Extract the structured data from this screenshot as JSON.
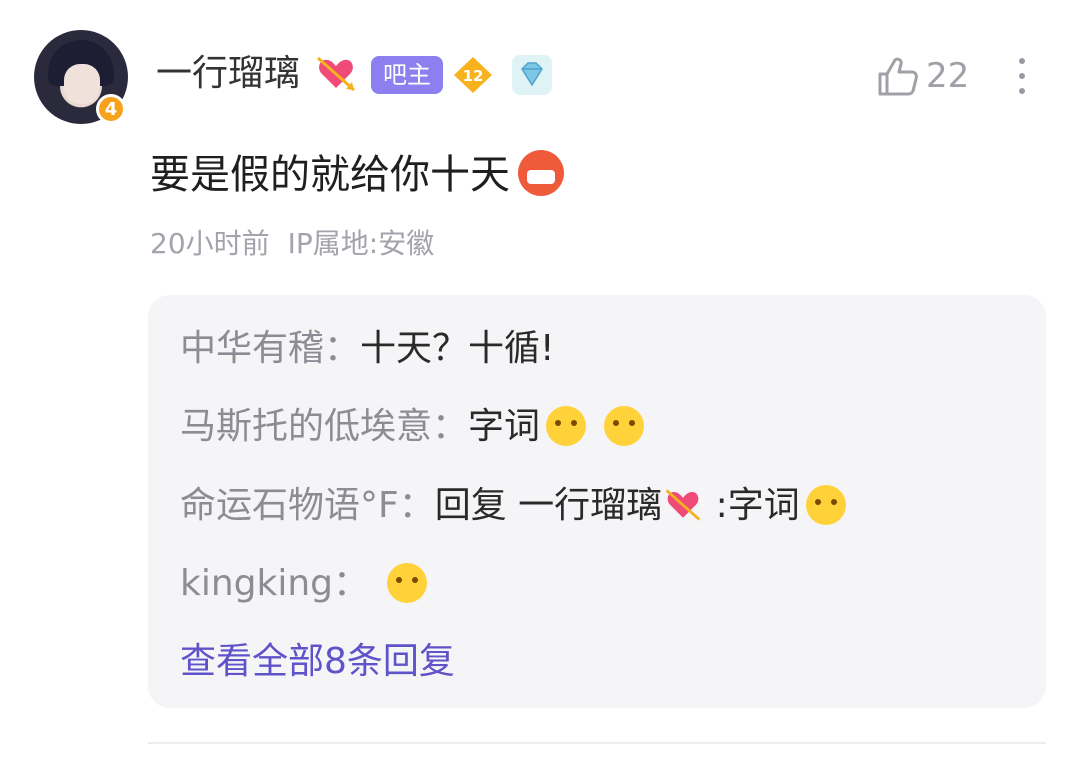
{
  "post": {
    "username": "一行瑠璃",
    "user_level": "4",
    "owner_badge": "吧主",
    "badge_level": "12",
    "likes": "22",
    "content": "要是假的就给你十天",
    "time": "20小时前",
    "ip_location": "IP属地:安徽"
  },
  "replies": [
    {
      "author": "中华有稽",
      "sep": "：",
      "text": "十天？十循!"
    },
    {
      "author": "马斯托的低埃意",
      "sep": "：",
      "text": "字词"
    },
    {
      "author": "命运石物语°F",
      "sep": "：",
      "prefix": "回复 一行瑠璃",
      "text": " :字词"
    },
    {
      "author": "kingking",
      "sep": "：",
      "text": ""
    }
  ],
  "view_all": "查看全部8条回复",
  "colors": {
    "accent": "#6052c9",
    "owner_badge_bg": "#8e7ff0",
    "meta_text": "#a3a3ab",
    "reply_bg": "#f5f5f7"
  },
  "icons": [
    "heart-arrow-icon",
    "level-badge-icon",
    "diamond-icon",
    "thumbs-up-icon",
    "more-vertical-icon",
    "angry-emoji-icon",
    "hugging-emoji-icon",
    "yum-emoji-icon"
  ]
}
